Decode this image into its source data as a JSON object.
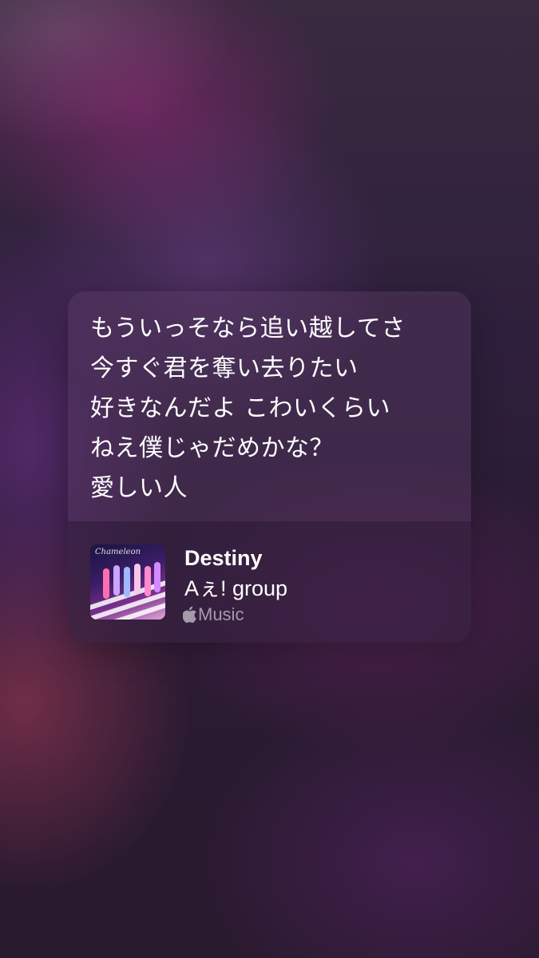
{
  "share_card": {
    "lyrics": [
      "もういっそなら追い越してさ",
      "今すぐ君を奪い去りたい",
      "好きなんだよ こわいくらい",
      "ねえ僕じゃだめかな？",
      "愛しい人"
    ],
    "song": {
      "title": "Destiny",
      "artist": "Aぇ! group",
      "artwork_icon": "album-artwork",
      "service_icon": "apple-logo-icon",
      "service_label": "Music"
    }
  },
  "colors": {
    "text": "#ffffff",
    "secondary_text": "#a995ad",
    "card_background": "#5a3c64"
  }
}
